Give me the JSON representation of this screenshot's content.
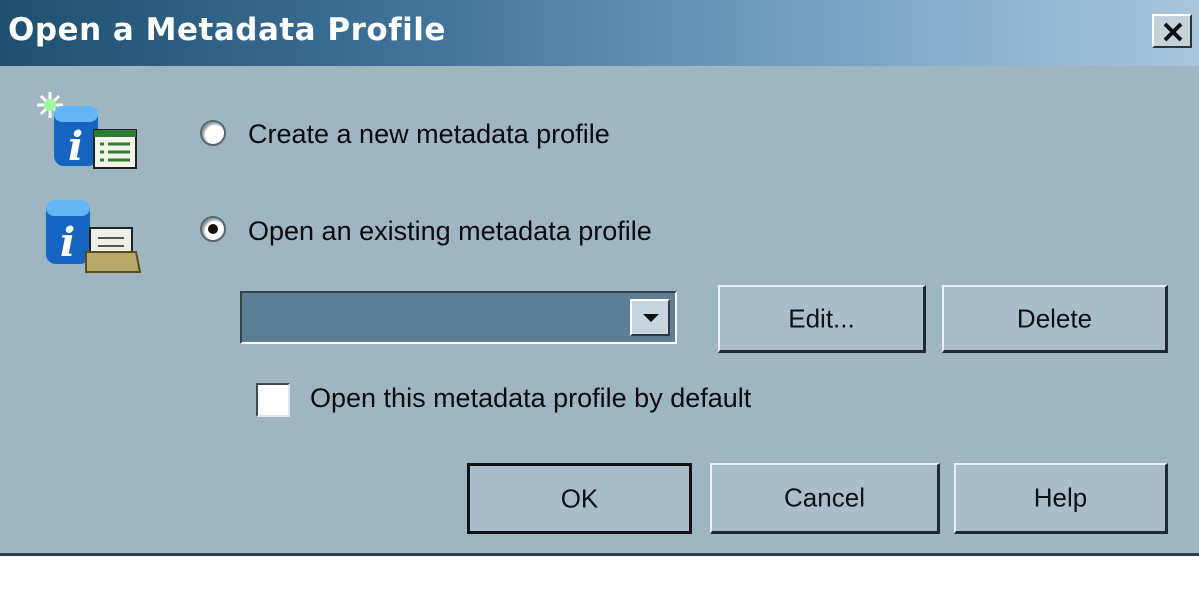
{
  "dialog": {
    "title": "Open a Metadata Profile",
    "close_icon": "close-icon"
  },
  "options": {
    "create": {
      "label": "Create a new metadata profile",
      "selected": false,
      "icon": "new-profile-icon"
    },
    "open": {
      "label": "Open an existing metadata profile",
      "selected": true,
      "icon": "open-profile-icon"
    }
  },
  "profile_select": {
    "value": "",
    "dropdown_icon": "chevron-down-icon"
  },
  "buttons": {
    "edit": "Edit...",
    "delete": "Delete",
    "ok": "OK",
    "cancel": "Cancel",
    "help": "Help"
  },
  "default_checkbox": {
    "label": "Open this metadata profile by default",
    "checked": false
  },
  "colors": {
    "dialog_bg": "#9eb6c2",
    "title_bar_start": "#1f4f6e",
    "title_bar_end": "#a9c6dc",
    "combo_bg": "#5c7f96"
  }
}
